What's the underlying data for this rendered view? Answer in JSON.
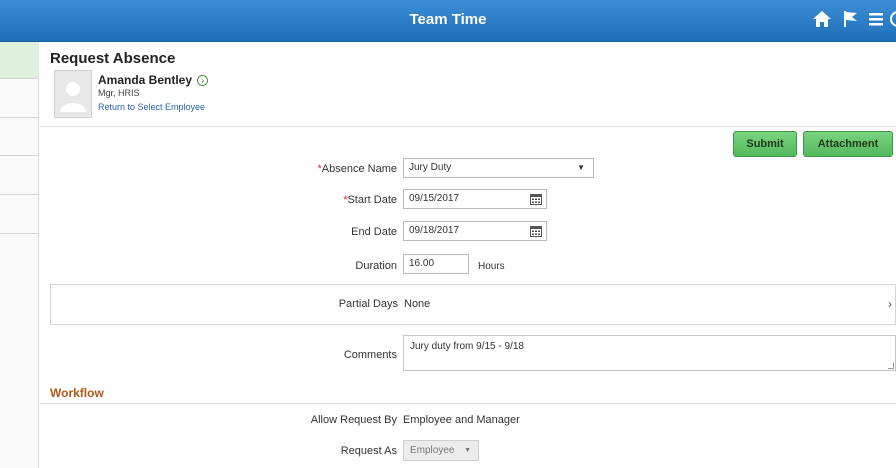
{
  "header": {
    "title": "Team Time"
  },
  "page": {
    "heading": "Request Absence"
  },
  "employee": {
    "name": "Amanda Bentley",
    "role": "Mgr, HRIS",
    "return_link": "Return to Select Employee"
  },
  "actions": {
    "submit_label": "Submit",
    "attachment_label": "Attachment"
  },
  "form": {
    "absence_name": {
      "label": "*Absence Name",
      "value": "Jury Duty"
    },
    "start_date": {
      "label": "*Start Date",
      "value": "09/15/2017"
    },
    "end_date": {
      "label": "End Date",
      "value": "09/18/2017"
    },
    "duration": {
      "label": "Duration",
      "value": "16.00",
      "unit": "Hours"
    },
    "partial_days": {
      "label": "Partial Days",
      "value": "None"
    },
    "comments": {
      "label": "Comments",
      "value": "Jury duty from 9/15 - 9/18"
    }
  },
  "workflow": {
    "heading": "Workflow",
    "allow_request_by": {
      "label": "Allow Request By",
      "value": "Employee and Manager"
    },
    "request_as": {
      "label": "Request As",
      "value": "Employee"
    }
  },
  "icons": {
    "home": "home-icon",
    "flag": "flag-icon",
    "menu": "hamburger-menu-icon",
    "nav": "navbar-icon",
    "calendar": "calendar-icon"
  },
  "colors": {
    "header": "#2b7cc8",
    "button": "#5cbf63",
    "workflow_heading": "#b05a1a",
    "link": "#2a64b2"
  }
}
